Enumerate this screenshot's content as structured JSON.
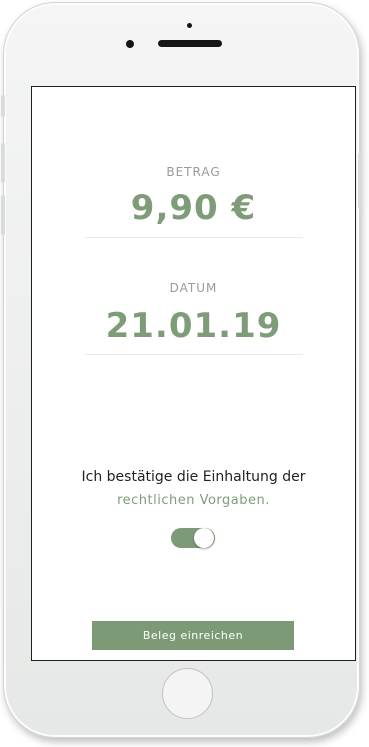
{
  "receipt": {
    "amount_label": "BETRAG",
    "amount_value": "9,90 €",
    "date_label": "DATUM",
    "date_value": "21.01.19"
  },
  "confirmation": {
    "text": "Ich bestätige die Einhaltung der",
    "link_text": "rechtlichen Vorgaben.",
    "toggle_on": true
  },
  "actions": {
    "submit_label": "Beleg einreichen"
  },
  "colors": {
    "accent": "#7f9c79",
    "label": "#9a9a9a",
    "text": "#222222"
  },
  "icons": {
    "home_button": "home-button-icon",
    "camera": "front-camera-icon"
  }
}
